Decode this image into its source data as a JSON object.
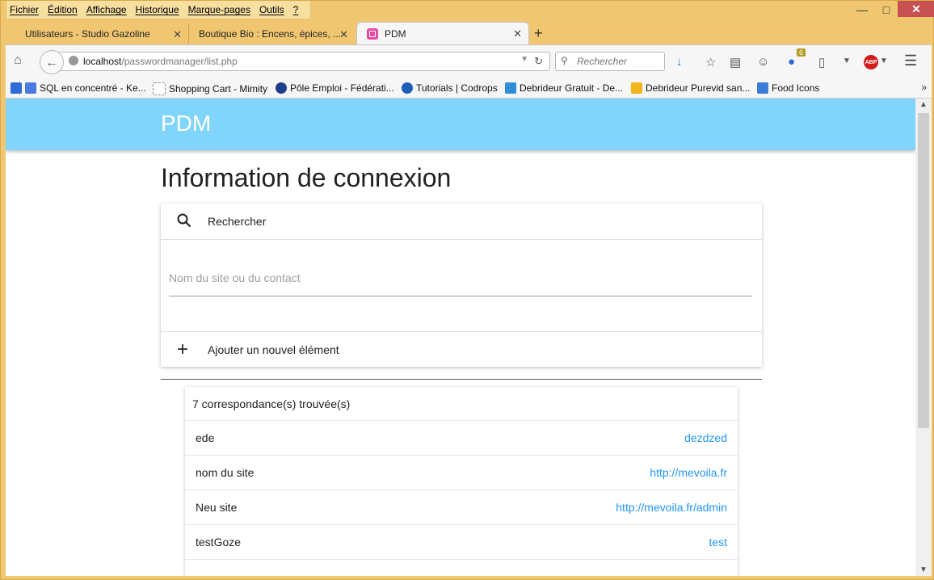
{
  "menubar": [
    "Fichier",
    "Édition",
    "Affichage",
    "Historique",
    "Marque-pages",
    "Outils",
    "?"
  ],
  "tabs": [
    {
      "label": "Utilisateurs - Studio Gazoline"
    },
    {
      "label": "Boutique Bio : Encens, épices, ..."
    },
    {
      "label": "PDM"
    }
  ],
  "nav": {
    "host": "localhost",
    "path": "/passwordmanager/list.php",
    "search_placeholder": "Rechercher",
    "ext_badge": "6",
    "abp": "ABP"
  },
  "bookmarks": [
    {
      "label": "SQL en concentré - Ke...",
      "color": "#2e6bd6"
    },
    {
      "label": "Shopping Cart - Mimity",
      "color": "#ffffff"
    },
    {
      "label": "Pôle Emploi - Fédérati...",
      "color": "#1d3e8a"
    },
    {
      "label": "Tutorials | Codrops",
      "color": "#1b5fb8"
    },
    {
      "label": "Debrideur Gratuit - De...",
      "color": "#2f8fd6"
    },
    {
      "label": "Debrideur Purevid san...",
      "color": "#f2b31b"
    },
    {
      "label": "Food Icons",
      "color": "#3a7bd5"
    }
  ],
  "app": {
    "brand": "PDM",
    "title": "Information de connexion",
    "search_label": "Rechercher",
    "field_placeholder": "Nom du site ou du contact",
    "add_label": "Ajouter un nouvel élément",
    "results_count": "7 correspondance(s) trouvée(s)",
    "items": [
      {
        "name": "ede",
        "value": "dezdzed"
      },
      {
        "name": "nom du site",
        "value": "http://mevoila.fr"
      },
      {
        "name": "Neu site",
        "value": "http://mevoila.fr/admin"
      },
      {
        "name": "testGoze",
        "value": "test"
      }
    ]
  },
  "colors": {
    "appbar": "#81d4fa",
    "link": "#2196f3"
  }
}
